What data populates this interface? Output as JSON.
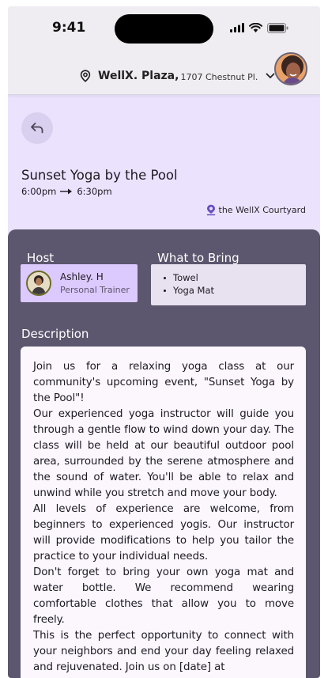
{
  "status_bar": {
    "time": "9:41"
  },
  "header": {
    "location_name": "WellX. Plaza,",
    "location_address": "1707 Chestnut Pl.",
    "icons": {
      "location": "location-pin-icon",
      "dropdown": "chevron-down-icon"
    }
  },
  "event": {
    "title": "Sunset Yoga by the Pool",
    "start_time": "6:00pm",
    "end_time": "6:30pm",
    "venue": "the WellX Courtyard"
  },
  "host": {
    "label": "Host",
    "name": "Ashley. H",
    "role": "Personal Trainer"
  },
  "bring": {
    "label": "What to Bring",
    "items": [
      "Towel",
      "Yoga Mat"
    ]
  },
  "description": {
    "label": "Description",
    "paragraphs": [
      "Join us for a relaxing yoga class at our community's upcoming event, \"Sunset Yoga by the Pool\"!",
      "Our experienced yoga instructor will guide you through a gentle flow to wind down your day. The class will be held at our beautiful outdoor pool area, surrounded by the serene atmosphere and the sound of water. You'll be able to relax and unwind while you stretch and move your body.",
      "All levels of experience are welcome, from beginners to experienced yogis. Our instructor will provide modifications to help you tailor the practice to your individual needs.",
      "Don't forget to bring your own yoga mat and water bottle. We recommend wearing comfortable clothes that allow you to move freely.",
      "This is the perfect opportunity to connect with your neighbors and end your day feeling relaxed and rejuvenated. Join us on [date] at"
    ]
  },
  "colors": {
    "page_bg": "#ebe3fd",
    "card_bg": "#5c566e",
    "host_bg": "#dcc9fd",
    "description_bg": "#fcf6fd"
  }
}
